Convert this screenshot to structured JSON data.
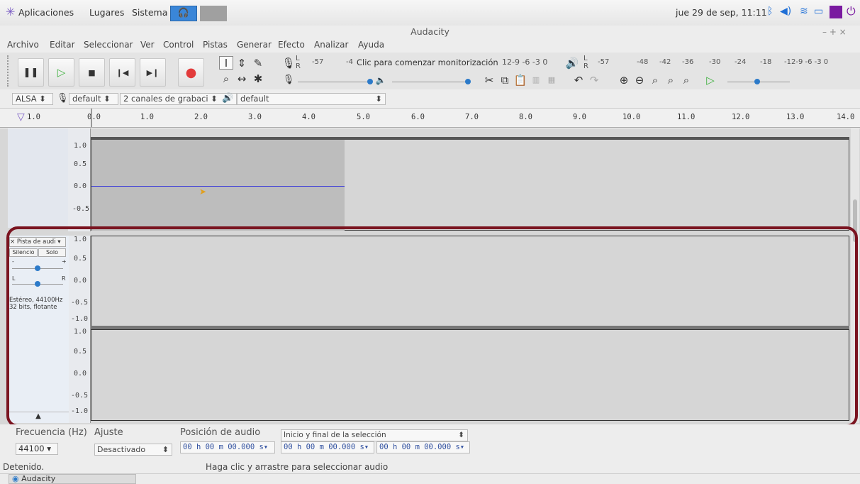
{
  "topbar": {
    "applications": "Aplicaciones",
    "places": "Lugares",
    "system": "Sistema",
    "clock": "jue 29 de sep, 11:11"
  },
  "window": {
    "title": "Audacity",
    "controls": "– + ×"
  },
  "menu": [
    "Archivo",
    "Editar",
    "Seleccionar",
    "Ver",
    "Control",
    "Pistas",
    "Generar",
    "Efecto",
    "Analizar",
    "Ayuda"
  ],
  "meters": {
    "rec_L": "L",
    "rec_R": "R",
    "rec_scale_left": "-57",
    "rec_scale_mid": "-4",
    "rec_prompt": "Clic para comenzar monitorización",
    "rec_scale_right": "12-9 -6 -3 0",
    "play_L": "L",
    "play_R": "R",
    "play_scale": [
      "-57",
      "-48",
      "-42",
      "-36",
      "-30",
      "-24",
      "-18",
      "-12-9 -6 -3 0"
    ]
  },
  "devices": {
    "host": "ALSA",
    "rec_device": "default",
    "channels": "2 canales de grabaci",
    "play_device": "default"
  },
  "ruler": {
    "labels": [
      "1.0",
      "0.0",
      "1.0",
      "2.0",
      "3.0",
      "4.0",
      "5.0",
      "6.0",
      "7.0",
      "8.0",
      "9.0",
      "10.0",
      "11.0",
      "12.0",
      "13.0",
      "14.0"
    ]
  },
  "track1": {
    "scale": [
      "1.0",
      "0.5",
      "0.0",
      "-0.5"
    ]
  },
  "track2": {
    "name": "Pista de audi",
    "close": "×",
    "mute": "Silencio",
    "solo": "Solo",
    "gain_minus": "-",
    "gain_plus": "+",
    "pan_L": "L",
    "pan_R": "R",
    "info1": "Estéreo, 44100Hz",
    "info2": "32 bits, flotante",
    "scale_top": [
      "1.0",
      "0.5",
      "0.0",
      "-0.5",
      "-1.0"
    ],
    "scale_bottom": [
      "1.0",
      "0.5",
      "0.0",
      "-0.5",
      "-1.0"
    ]
  },
  "selectionbar": {
    "rate_label": "Frecuencia (Hz)",
    "rate_value": "44100",
    "snap_label": "Ajuste",
    "snap_value": "Desactivado",
    "pos_label": "Posición de audio",
    "pos_value": "00 h 00 m 00.000 s",
    "sel_mode": "Inicio y final de la selección",
    "sel_start": "00 h 00 m 00.000 s",
    "sel_end": "00 h 00 m 00.000 s"
  },
  "status": {
    "state": "Detenido.",
    "hint": "Haga clic y arrastre para seleccionar audio"
  },
  "taskbar": {
    "app": "Audacity"
  },
  "colors": {
    "highlight": "#7a1420",
    "record": "#e23b3b",
    "play": "#3fb03f",
    "accent": "#2c7ac9"
  }
}
